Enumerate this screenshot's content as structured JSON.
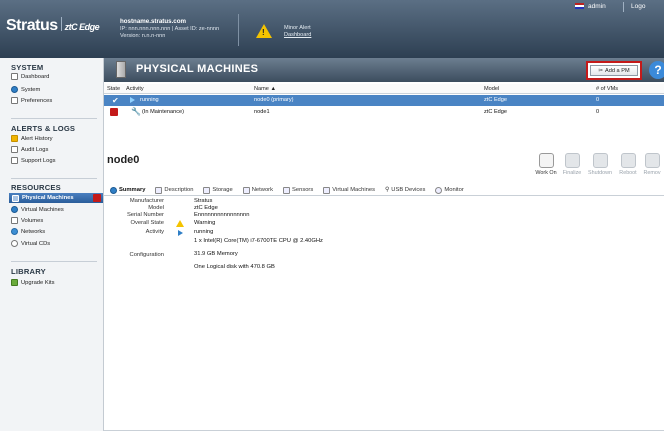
{
  "header": {
    "logo_text": "Stratus",
    "logo_product": "ztC Edge",
    "hostname": "hostname.stratus.com",
    "ip_line": "IP: nnn.nnn.nnn.nnn | Asset ID: ze-nnnn",
    "version_line": "Version: n.n.n-nnn",
    "alert_title": "Minor Alert",
    "alert_link": "Dashboard",
    "user": "admin",
    "logout": "Logo"
  },
  "sidebar": {
    "system": {
      "title": "SYSTEM",
      "items": [
        {
          "label": "Dashboard"
        },
        {
          "label": "System"
        },
        {
          "label": "Preferences"
        }
      ]
    },
    "alerts": {
      "title": "ALERTS & LOGS",
      "items": [
        {
          "label": "Alert History"
        },
        {
          "label": "Audit Logs"
        },
        {
          "label": "Support Logs"
        }
      ]
    },
    "resources": {
      "title": "RESOURCES",
      "items": [
        {
          "label": "Physical Machines"
        },
        {
          "label": "Virtual Machines"
        },
        {
          "label": "Volumes"
        },
        {
          "label": "Networks"
        },
        {
          "label": "Virtual CDs"
        }
      ]
    },
    "library": {
      "title": "LIBRARY",
      "items": [
        {
          "label": "Upgrade Kits"
        }
      ]
    }
  },
  "pm": {
    "title": "PHYSICAL MACHINES",
    "add_label": "Add a PM",
    "columns": {
      "state": "State",
      "activity": "Activity",
      "name": "Name ▲",
      "model": "Model",
      "vms": "# of VMs"
    },
    "rows": [
      {
        "activity": "running",
        "name": "node0 (primary)",
        "model": "ztC Edge",
        "vms": "0"
      },
      {
        "activity": "(In Maintenance)",
        "name": "node1",
        "model": "ztC Edge",
        "vms": "0"
      }
    ]
  },
  "detail": {
    "title": "node0",
    "actions": [
      "Work On",
      "Finalize",
      "Shutdown",
      "Reboot",
      "Remov"
    ],
    "tabs": [
      "Summary",
      "Description",
      "Storage",
      "Network",
      "Sensors",
      "Virtual Machines",
      "USB Devices",
      "Monitor"
    ],
    "labels": {
      "manufacturer": "Manufacturer",
      "model": "Model",
      "serial": "Serial Number",
      "overall": "Overall State",
      "activity": "Activity",
      "configuration": "Configuration"
    },
    "values": {
      "manufacturer": "Stratus",
      "model": "ztC Edge",
      "serial": "Ennnnnnnnnnnnnnnn",
      "overall": "Warning",
      "activity": "running",
      "cpu": "1 x Intel(R) Core(TM) i7-6700TE CPU @ 2.40GHz",
      "memory": "31.9 GB Memory",
      "disk": "One Logical disk with 470.8 GB"
    }
  }
}
